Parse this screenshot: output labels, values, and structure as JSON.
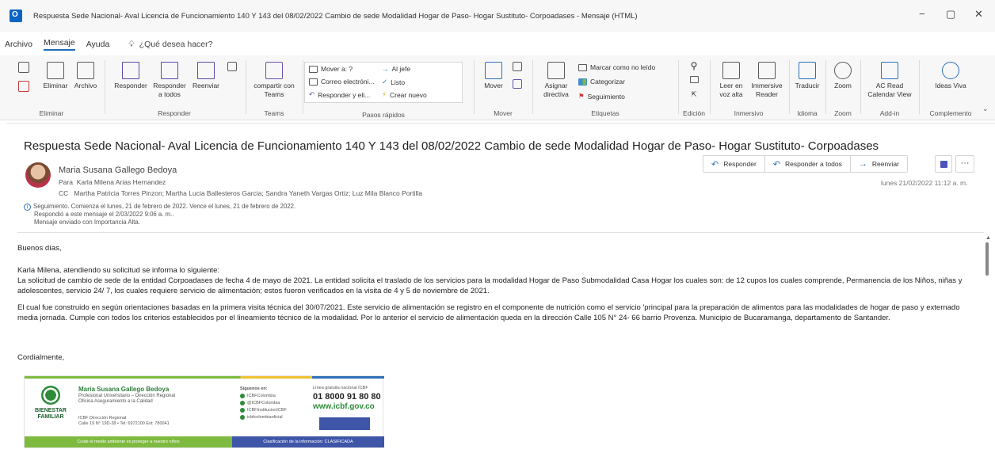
{
  "window": {
    "title": "Respuesta Sede Nacional- Aval Licencia de Funcionamiento 140 Y 143 del 08/02/2022 Cambio de sede Modalidad Hogar de Paso- Hogar Sustituto- Corpoadases - Mensaje (HTML)",
    "minimize": "−",
    "restore": "▢",
    "close": "✕"
  },
  "menu": {
    "items": [
      "Archivo",
      "Mensaje",
      "Ayuda"
    ],
    "active": "Mensaje",
    "tellme": "¿Qué desea hacer?"
  },
  "ribbon": {
    "eliminar": {
      "delete": "Eliminar",
      "archive": "Archivo",
      "label": "Eliminar"
    },
    "responder": {
      "reply": "Responder",
      "reply_all": "Responder a todos",
      "forward": "Reenviar",
      "label": "Responder"
    },
    "teams": {
      "share": "compartir con Teams",
      "label": "Teams"
    },
    "quick": {
      "move_to": "Mover a: ?",
      "to_boss": "Al jefe",
      "email": "Correo electróni...",
      "done": "Listo",
      "reply_delete": "Responder y eli...",
      "create_new": "Crear nuevo",
      "label": "Pasos rápidos"
    },
    "mover": {
      "move": "Mover",
      "label": "Mover"
    },
    "etiquetas": {
      "assign": "Asignar directiva",
      "unread": "Marcar como no leído",
      "categorize": "Categorizar",
      "followup": "Seguimiento",
      "label": "Etiquetas"
    },
    "edicion": {
      "label": "Edición"
    },
    "inmersivo": {
      "read_aloud": "Leer en voz alta",
      "immersive": "Immersive Reader",
      "label": "Inmersivo"
    },
    "idioma": {
      "translate": "Traducir",
      "label": "Idioma"
    },
    "zoom": {
      "zoom": "Zoom",
      "label": "Zoom"
    },
    "addin": {
      "acread": "AC Read Calendar View",
      "label": "Add-in"
    },
    "complemento": {
      "ideas": "Ideas Viva",
      "label": "Complemento"
    }
  },
  "message": {
    "subject": "Respuesta Sede Nacional- Aval Licencia de Funcionamiento 140 Y 143 del 08/02/2022 Cambio de sede Modalidad Hogar de Paso- Hogar Sustituto- Corpoadases",
    "sender": "Maria Susana Gallego Bedoya",
    "to_label": "Para",
    "to": "Karla Milena Arias Hernandez",
    "cc_label": "CC",
    "cc": "Martha Patricia Torres Pinzon; Martha Lucia Ballesteros Garcia; Sandra Yaneth Vargas Ortiz; Luz Mila Blanco Portilla",
    "info_line1": "Seguimiento.  Comienza el lunes, 21 de febrero de 2022.  Vence el lunes, 21 de febrero de 2022.",
    "info_line2": "Respondió a este mensaje el 2/03/2022 9:06 a. m..",
    "info_line3": "Mensaje enviado con Importancia Alta.",
    "date": "lunes 21/02/2022 11:12 a. m.",
    "actions": {
      "reply": "Responder",
      "reply_all": "Responder a todos",
      "forward": "Reenviar",
      "more": "···"
    },
    "body": {
      "greeting": "Buenos días,",
      "p1": "Karla Milena, atendiendo su solicitud se informa lo siguiente:",
      "p2": " La solicitud de cambio de sede de la entidad Corpoadases de fecha 4 de mayo de 2021. La entidad solicita el traslado de los servicios para la modalidad Hogar de Paso Submodalidad Casa Hogar los cuales son: de 12 cupos los cuales comprende, Permanencia de los Niños, niñas y adolescentes, servicio 24/ 7, los cuales requiere servicio de alimentación; estos fueron verificados en la visita de 4 y 5 de noviembre de 2021.",
      "p3": "El cual fue construido en según orientaciones basadas en la primera visita técnica del 30/07/2021. Este servicio de alimentación se registro en el componente de nutrición como el servicio 'principal para la preparación de alimentos para las modalidades de hogar de paso y externado media jornada. Cumple con todos los criterios establecidos por el lineamiento técnico de la modalidad. Por lo anterior el servicio de alimentación queda en la dirección Calle 105 N° 24- 66 barrio Provenza. Municipio de Bucaramanga, departamento de Santander.",
      "closing": "Cordialmente,"
    }
  },
  "signature": {
    "logo_text": "BIENESTAR FAMILIAR",
    "name": "María Susana Gallego Bedoya",
    "role1": "Profesional Universitario – Dirección Regional",
    "role2": "Oficina Aseguramiento a la Calidad",
    "addr1": "ICBF Dirección Regional",
    "addr2": "Calle 19 N° 19D-38 • Tel: 6972100 Ext: 780041",
    "social_title": "Síguenos en:",
    "social1": "ICBFColombia",
    "social2": "@ICBFColombia",
    "social3": "ICBFInstitucionICBF",
    "social4": "icbfcolombiaoficial",
    "line_title": "Línea gratuita nacional ICBF",
    "phone": "01 8000 91 80 80",
    "web": "www.icbf.gov.co",
    "footer_left": "Cuide el medio ambiente es proteger a nuestro niños",
    "footer_right": "Clasificación de la información: CLASIFICADA"
  }
}
